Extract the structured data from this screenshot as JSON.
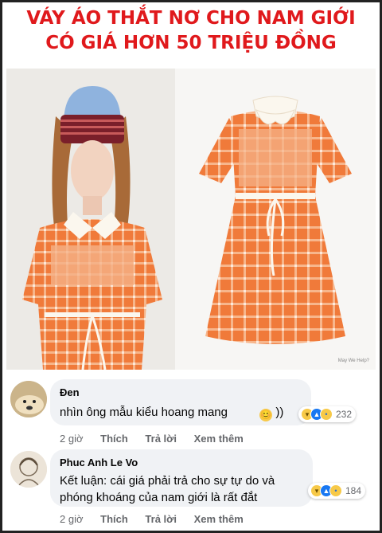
{
  "headline": {
    "line1": "VÁY ÁO THẮT NƠ CHO NAM GIỚI",
    "line2": "CÓ GIÁ HƠN 50 TRIỆU ĐỒNG"
  },
  "photo": {
    "watermark": "May We Help?"
  },
  "colors": {
    "headline": "#e0191c",
    "dress_orange": "#f07a3a",
    "bubble_bg": "#f0f2f5",
    "like_blue": "#1877f2"
  },
  "comments": [
    {
      "author": "Đen",
      "text": "nhìn ông mẫu kiểu hoang mang",
      "trailing_emoji": "😊",
      "trailing_text": "))",
      "reaction_icons": [
        "haha-icon",
        "like-icon",
        "sad-icon"
      ],
      "reaction_count": "232",
      "time": "2 giờ",
      "like_label": "Thích",
      "reply_label": "Trả lời",
      "more_label": "Xem thêm"
    },
    {
      "author": "Phuc Anh Le Vo",
      "text_line1": "Kết luận: cái giá phải trả cho sự tự do và",
      "text_line2": "phóng khoáng của nam giới là rất đắt",
      "reaction_icons": [
        "haha-icon",
        "like-icon",
        "sad-icon"
      ],
      "reaction_count": "184",
      "time": "2 giờ",
      "like_label": "Thích",
      "reply_label": "Trả lời",
      "more_label": "Xem thêm"
    }
  ]
}
